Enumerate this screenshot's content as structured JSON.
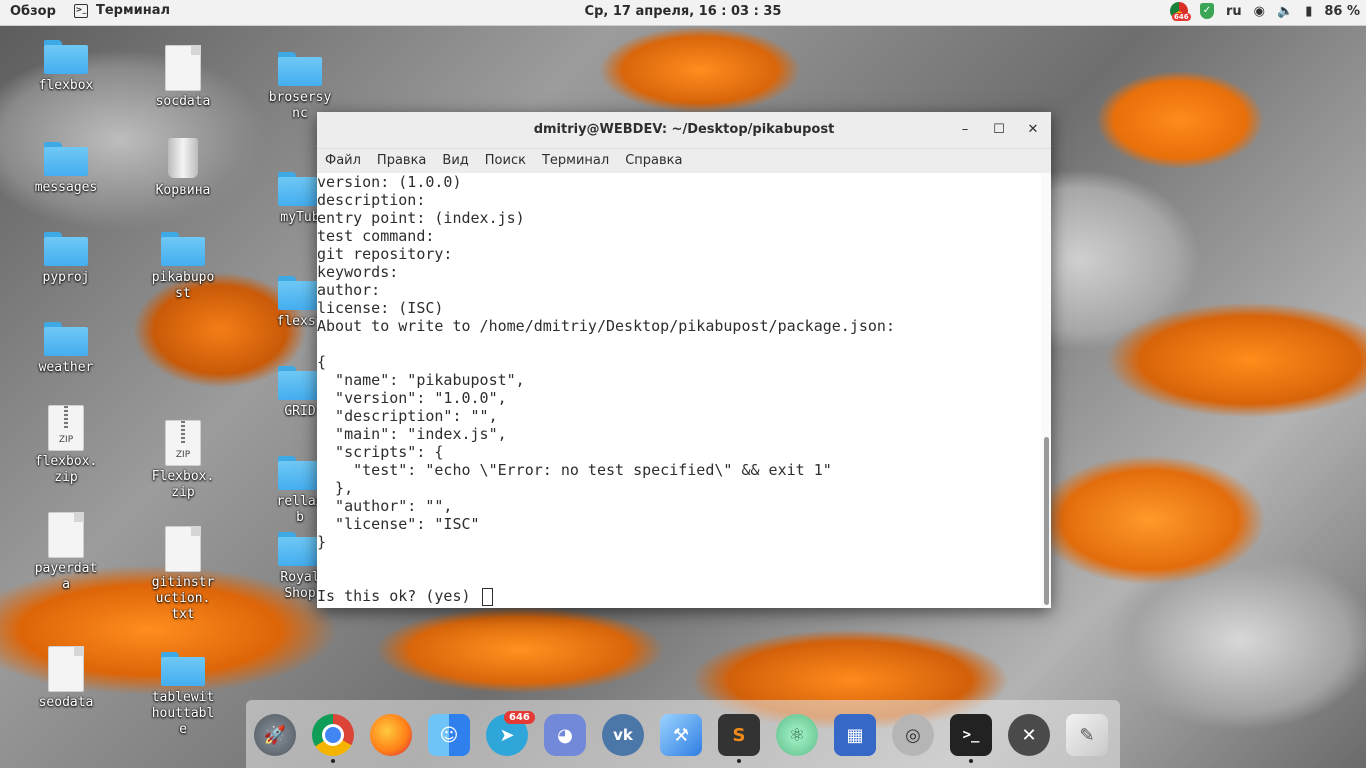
{
  "topbar": {
    "overview": "Обзор",
    "app_name": "Терминал",
    "clock": "Ср, 17 апреля, 16 : 03 : 35",
    "chrome_badge": "646",
    "lang": "ru",
    "battery": "86 %"
  },
  "desktop": {
    "icons": [
      {
        "label": "flexbox",
        "type": "folder"
      },
      {
        "label": "socdata",
        "type": "file"
      },
      {
        "label": "brosersy\nnc",
        "type": "folder"
      },
      {
        "label": "messages",
        "type": "folder"
      },
      {
        "label": "Корвина",
        "type": "trash"
      },
      {
        "label": "myTub",
        "type": "folder"
      },
      {
        "label": "pyproj",
        "type": "folder"
      },
      {
        "label": "pikabupo\nst",
        "type": "folder"
      },
      {
        "label": "flexsl",
        "type": "folder"
      },
      {
        "label": "weather",
        "type": "folder"
      },
      {
        "label": "GRID",
        "type": "folder"
      },
      {
        "label": "flexbox.\nzip",
        "type": "zip"
      },
      {
        "label": "Flexbox.\nzip",
        "type": "zip"
      },
      {
        "label": "rellax\nb",
        "type": "folder"
      },
      {
        "label": "payerdat\na",
        "type": "file"
      },
      {
        "label": "gitinstr\nuction.\ntxt",
        "type": "file"
      },
      {
        "label": "Royal\nShop",
        "type": "folder"
      },
      {
        "label": "seodata",
        "type": "file"
      },
      {
        "label": "tablewit\nhouttabl\ne",
        "type": "folder"
      }
    ]
  },
  "window": {
    "title": "dmitriy@WEBDEV: ~/Desktop/pikabupost",
    "minimize": "–",
    "maximize": "☐",
    "close": "✕",
    "menu": [
      "Файл",
      "Правка",
      "Вид",
      "Поиск",
      "Терминал",
      "Справка"
    ]
  },
  "terminal": {
    "lines": [
      "version: (1.0.0)",
      "description:",
      "entry point: (index.js)",
      "test command:",
      "git repository:",
      "keywords:",
      "author:",
      "license: (ISC)",
      "About to write to /home/dmitriy/Desktop/pikabupost/package.json:",
      "",
      "{",
      "  \"name\": \"pikabupost\",",
      "  \"version\": \"1.0.0\",",
      "  \"description\": \"\",",
      "  \"main\": \"index.js\",",
      "  \"scripts\": {",
      "    \"test\": \"echo \\\"Error: no test specified\\\" && exit 1\"",
      "  },",
      "  \"author\": \"\",",
      "  \"license\": \"ISC\"",
      "}",
      "",
      "",
      "Is this ok? (yes) "
    ]
  },
  "dock": {
    "telegram_badge": "646",
    "apps": [
      {
        "name": "Launcher",
        "icon": "rocket-icon",
        "color": "#5f6770"
      },
      {
        "name": "Google Chrome",
        "icon": "chrome-icon",
        "color": "#db4437"
      },
      {
        "name": "Firefox",
        "icon": "firefox-icon",
        "color": "#ff7b17"
      },
      {
        "name": "Finder",
        "icon": "finder-icon",
        "color": "#3a8ee6"
      },
      {
        "name": "Telegram",
        "icon": "telegram-icon",
        "color": "#2ea6da"
      },
      {
        "name": "Discord",
        "icon": "discord-icon",
        "color": "#7289da"
      },
      {
        "name": "VK",
        "icon": "vk-icon",
        "color": "#4a76a8"
      },
      {
        "name": "Xcode",
        "icon": "xcode-icon",
        "color": "#2f7ee3"
      },
      {
        "name": "Sublime Text",
        "icon": "sublime-icon",
        "color": "#f28a1a"
      },
      {
        "name": "Atom",
        "icon": "atom-icon",
        "color": "#5ebc8a"
      },
      {
        "name": "Files",
        "icon": "files-icon",
        "color": "#3568c7"
      },
      {
        "name": "Cheese",
        "icon": "cheese-icon",
        "color": "#8c8c8c"
      },
      {
        "name": "Terminal",
        "icon": "terminal-icon",
        "color": "#222222"
      },
      {
        "name": "Settings",
        "icon": "settings-icon",
        "color": "#4a4a4a"
      },
      {
        "name": "Text Editor",
        "icon": "texteditor-icon",
        "color": "#dcdcdc"
      }
    ]
  }
}
